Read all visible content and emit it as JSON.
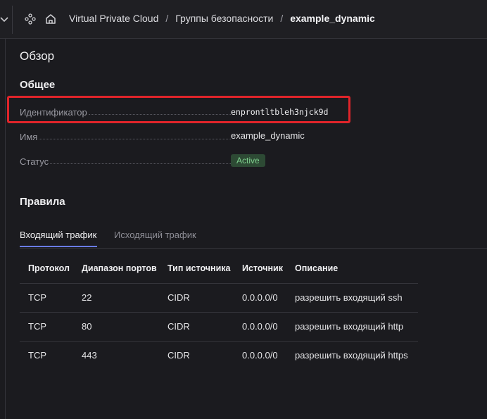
{
  "breadcrumbs": {
    "items": [
      "Virtual Private Cloud",
      "Группы безопасности"
    ],
    "separator": "/",
    "current": "example_dynamic"
  },
  "overview": {
    "title": "Обзор",
    "general_title": "Общее",
    "fields": [
      {
        "label": "Идентификатор",
        "value": "enprontltbleh3njck9d"
      },
      {
        "label": "Имя",
        "value": "example_dynamic"
      },
      {
        "label": "Статус",
        "value": "Active"
      }
    ],
    "status_color": "#7fd08e"
  },
  "rules": {
    "title": "Правила",
    "tabs": [
      {
        "label": "Входящий трафик",
        "active": true
      },
      {
        "label": "Исходящий трафик",
        "active": false
      }
    ],
    "columns": [
      "Протокол",
      "Диапазон портов",
      "Тип источника",
      "Источник",
      "Описание"
    ],
    "rows": [
      [
        "TCP",
        "22",
        "CIDR",
        "0.0.0.0/0",
        "разрешить входящий ssh"
      ],
      [
        "TCP",
        "80",
        "CIDR",
        "0.0.0.0/0",
        "разрешить входящий http"
      ],
      [
        "TCP",
        "443",
        "CIDR",
        "0.0.0.0/0",
        "разрешить входящий https"
      ]
    ]
  },
  "colors": {
    "accent": "#6a7cf0",
    "highlight": "#e0242a"
  }
}
